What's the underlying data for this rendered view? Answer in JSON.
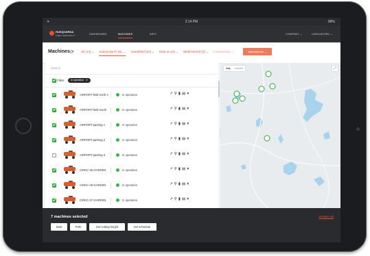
{
  "statusbar": {
    "time": "2:14 PM",
    "battery": "88%",
    "wifi": "✈"
  },
  "brand": {
    "name": "HUSQVARNA",
    "sub": "FLEET SERVICES™"
  },
  "nav": {
    "tabs": [
      {
        "label": "DASHBOARD",
        "active": false
      },
      {
        "label": "MACHINES",
        "active": true
      },
      {
        "label": "INFO",
        "active": false
      }
    ],
    "company": "COMPANY",
    "user": "LINDA BJORK"
  },
  "toolbar": {
    "title": "Machines",
    "refresh_icon": "refresh-icon",
    "filters": [
      {
        "label": "All",
        "count": "(14)",
        "state": "normal"
      },
      {
        "label": "Automower®",
        "count": "(9)",
        "state": "selected"
      },
      {
        "label": "Handheld",
        "count": "(10)",
        "state": "normal"
      },
      {
        "label": "Ride on",
        "count": "(4)",
        "state": "normal"
      },
      {
        "label": "Walk behind",
        "count": "(3)",
        "state": "normal"
      },
      {
        "label": "Construction",
        "count": "",
        "state": "dim"
      }
    ],
    "extra_button": "Attachments"
  },
  "list": {
    "search_placeholder": "Search",
    "filter_label": "Filter",
    "filter_chip": "In operation",
    "machines": [
      {
        "name": "AIRPORT-field-north-1",
        "status": "In operation",
        "checked": true,
        "color": "#d2622f"
      },
      {
        "name": "AIRPORT-field-south",
        "status": "In operation",
        "checked": true,
        "color": "#d2622f"
      },
      {
        "name": "AIRPORT-parking-1",
        "status": "In operation",
        "checked": true,
        "color": "#d2622f"
      },
      {
        "name": "AIRPORT-parking-2",
        "status": "In operation",
        "checked": true,
        "color": "#d2622f"
      },
      {
        "name": "AIRPORT-parking-3",
        "status": "In operation",
        "checked": false,
        "color": "#d2622f"
      },
      {
        "name": "CIRKC-35-GARDEN",
        "status": "In operation",
        "checked": true,
        "color": "#e0592e"
      },
      {
        "name": "CIRKC-36-GARDEN",
        "status": "In operation",
        "checked": true,
        "color": "#e0592e"
      },
      {
        "name": "CIRKC-37-GARDEN",
        "status": "In operation",
        "checked": true,
        "color": "#e0592e"
      }
    ],
    "row_icons": "↗ ⚲ ▮ ▤ ▾"
  },
  "map": {
    "type_map": "Map",
    "type_satellite": "Satellite",
    "fullscreen": "⤢"
  },
  "bottom": {
    "title": "7 machines selected",
    "deselect": "Deselect all",
    "actions": [
      "Start",
      "Park",
      "Set cutting height",
      "Set schedule"
    ]
  },
  "colors": {
    "accent": "#e8502f",
    "status_ok": "#33b845",
    "check": "#2eaa3b"
  }
}
